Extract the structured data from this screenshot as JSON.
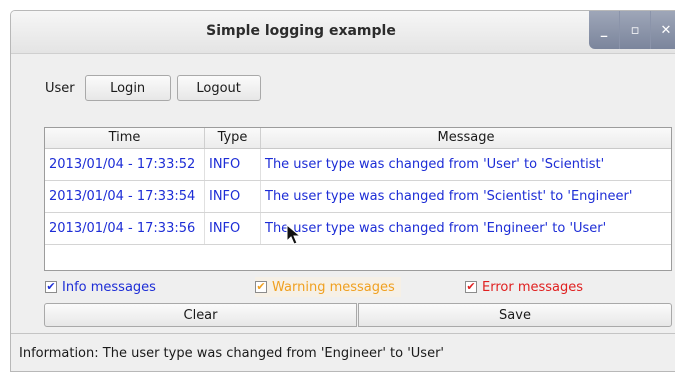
{
  "window": {
    "title": "Simple logging example",
    "controls": {
      "minimize": "_",
      "maximize": "▫",
      "close": "✕"
    }
  },
  "user": {
    "label": "User",
    "login_label": "Login",
    "logout_label": "Logout"
  },
  "table": {
    "columns": [
      "Time",
      "Type",
      "Message"
    ],
    "rows": [
      {
        "time": "2013/01/04 - 17:33:52",
        "type": "INFO",
        "message": "The user type was changed from 'User' to 'Scientist'"
      },
      {
        "time": "2013/01/04 - 17:33:54",
        "type": "INFO",
        "message": "The user type was changed from 'Scientist' to 'Engineer'"
      },
      {
        "time": "2013/01/04 - 17:33:56",
        "type": "INFO",
        "message": "The user type was changed from 'Engineer' to 'User'"
      }
    ],
    "row_color": "#1d2dd6"
  },
  "filters": {
    "info": {
      "label": "Info messages",
      "checked": true,
      "color": "#1d2dd6"
    },
    "warning": {
      "label": "Warning messages",
      "checked": true,
      "color": "#f0a020"
    },
    "error": {
      "label": "Error messages",
      "checked": true,
      "color": "#e02020"
    }
  },
  "actions": {
    "clear_label": "Clear",
    "save_label": "Save"
  },
  "status": {
    "text": "Information: The user type was changed from 'Engineer' to 'User'"
  }
}
